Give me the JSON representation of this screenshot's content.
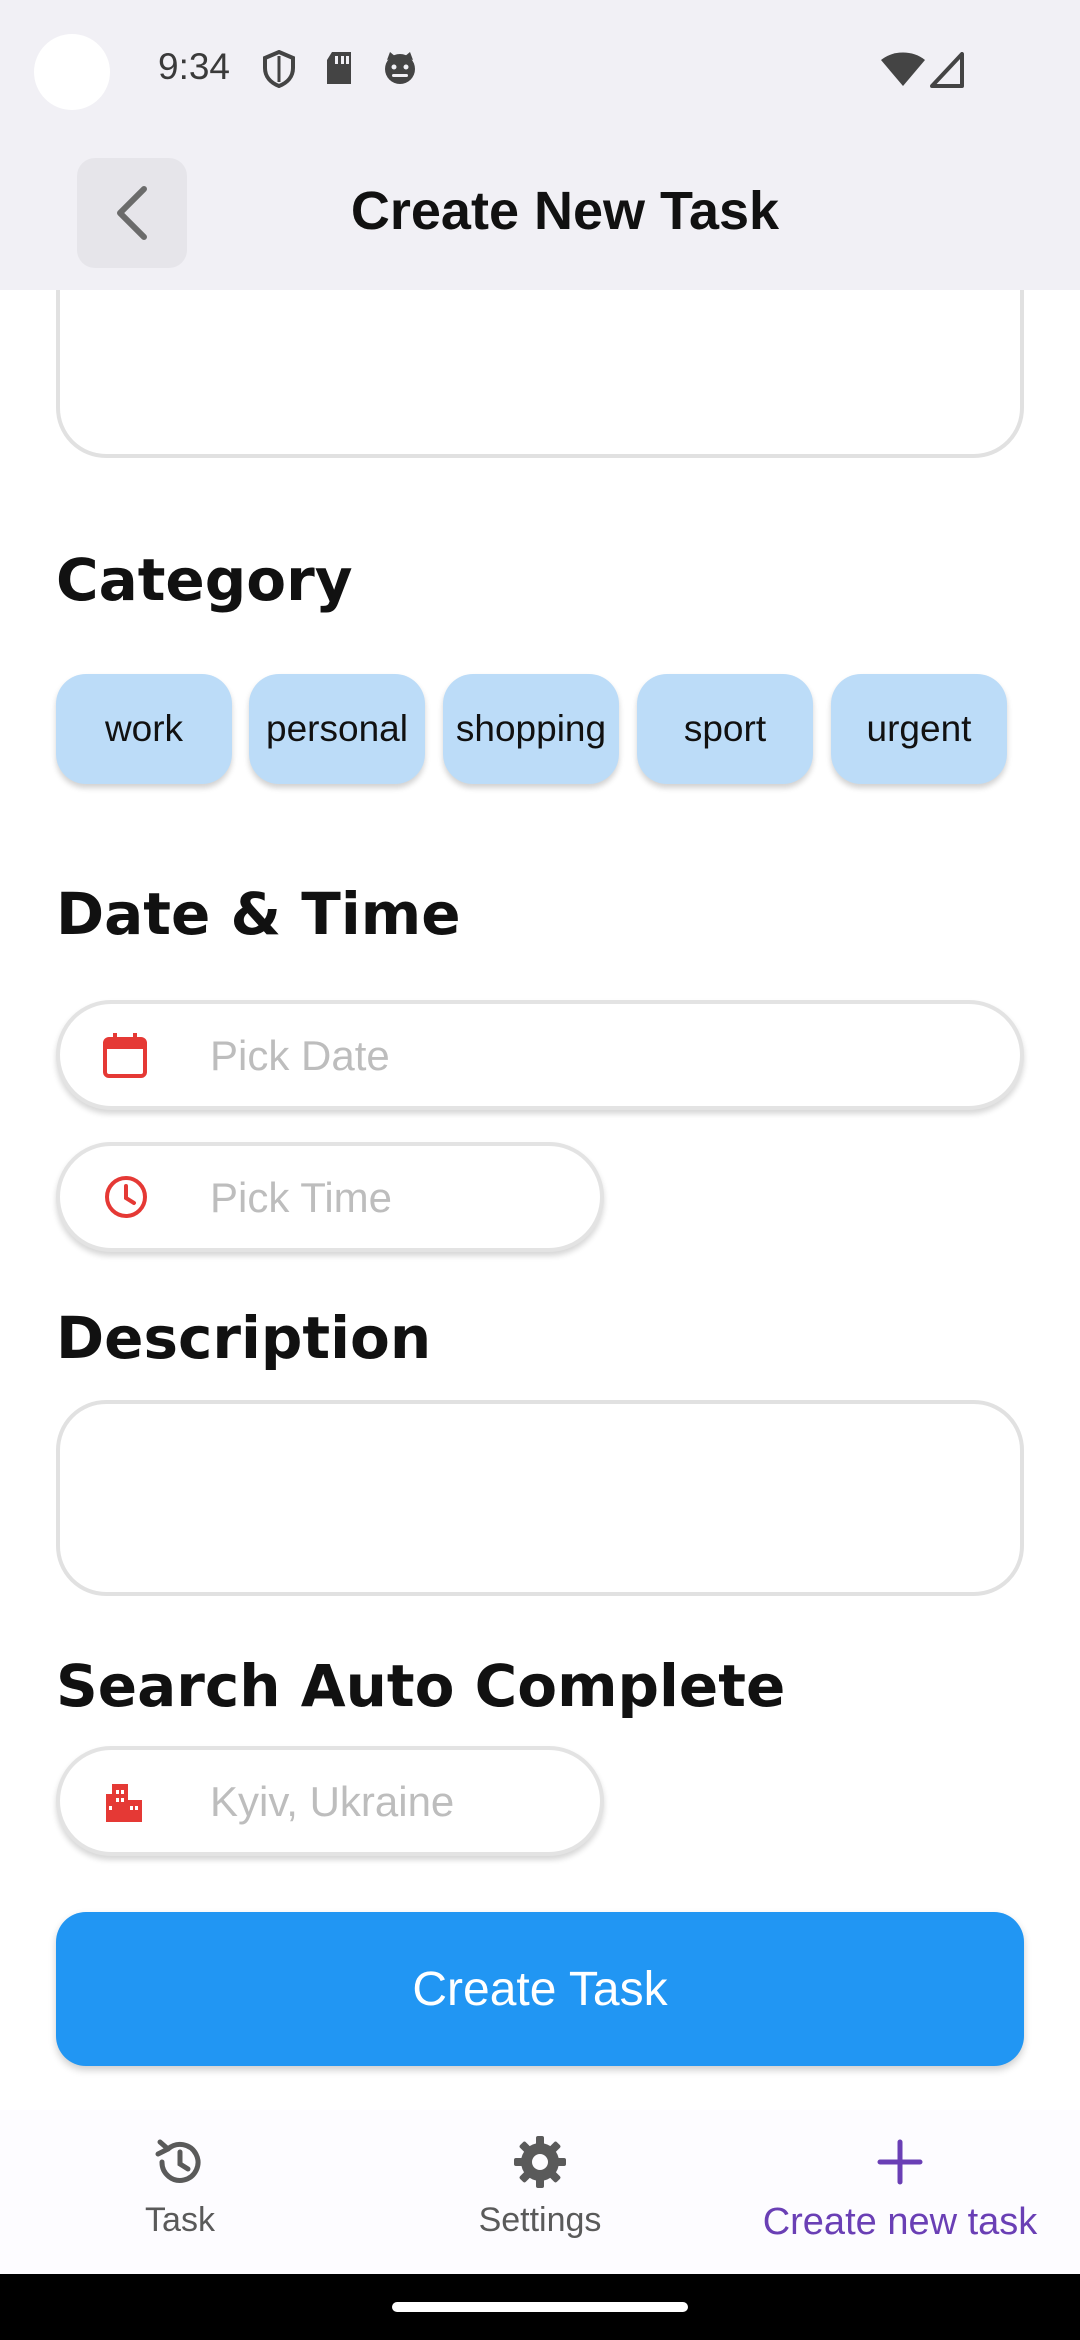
{
  "status_bar": {
    "time": "9:34",
    "icons": [
      "shield-icon",
      "sd-card-icon",
      "cat-face-icon",
      "wifi-icon",
      "cell-signal-icon"
    ]
  },
  "app_bar": {
    "title": "Create New Task",
    "back_icon": "chevron-left-icon"
  },
  "form": {
    "category": {
      "heading": "Category",
      "chips": [
        "work",
        "personal",
        "shopping",
        "sport",
        "urgent"
      ],
      "chip_color": "#bcdcf8"
    },
    "date_time": {
      "heading": "Date & Time",
      "date_placeholder": "Pick Date",
      "time_placeholder": "Pick Time",
      "icon_color": "#e53935"
    },
    "description": {
      "heading": "Description",
      "value": ""
    },
    "search": {
      "heading": "Search Auto Complete",
      "placeholder": "Kyiv, Ukraine"
    },
    "submit_label": "Create Task",
    "submit_color": "#2196f3"
  },
  "bottom_nav": {
    "items": [
      {
        "label": "Task",
        "icon": "history-icon"
      },
      {
        "label": "Settings",
        "icon": "gear-icon"
      },
      {
        "label": "Create new task",
        "icon": "plus-icon",
        "active": true
      }
    ],
    "active_color": "#6a3fb5"
  }
}
